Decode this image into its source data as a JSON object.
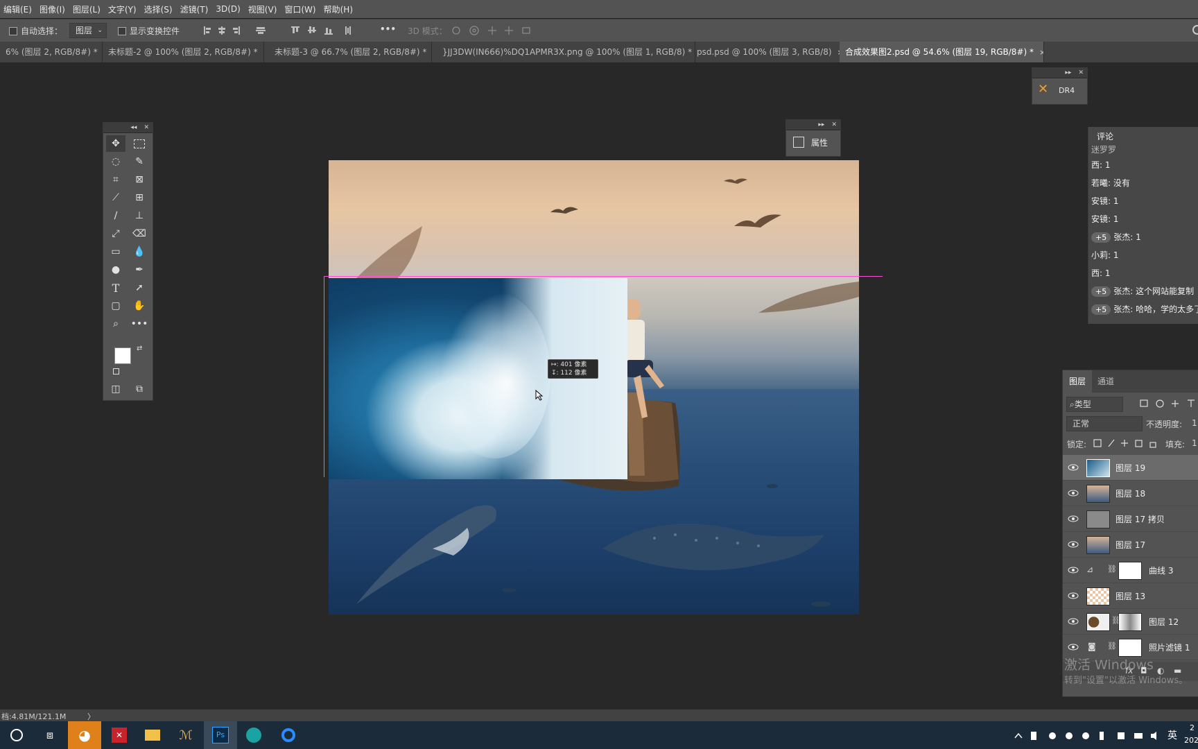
{
  "menu": [
    "编辑(E)",
    "图像(I)",
    "图层(L)",
    "文字(Y)",
    "选择(S)",
    "滤镜(T)",
    "3D(D)",
    "视图(V)",
    "窗口(W)",
    "帮助(H)"
  ],
  "options": {
    "auto_select_label": "自动选择：",
    "auto_select_value": "图层",
    "show_transform_label": "显示变换控件",
    "more": "•••",
    "mode_3d": "3D 模式："
  },
  "tabs": [
    {
      "label": "6% (图层 2, RGB/8#) *",
      "close": "×"
    },
    {
      "label": "未标题-2 @ 100% (图层 2, RGB/8#) *",
      "close": "×"
    },
    {
      "label": "未标题-3 @ 66.7% (图层 2, RGB/8#) *",
      "close": "×"
    },
    {
      "label": "}JJ3DW(IN666)%DQ1APMR3X.png @ 100% (图层 1, RGB/8) *",
      "close": "×"
    },
    {
      "label": "psd.psd @ 100% (图层 3, RGB/8)",
      "close": "×"
    },
    {
      "label": "合成效果图2.psd @ 54.6% (图层 19, RGB/8#) *",
      "close": "×"
    }
  ],
  "tooltip": {
    "line1": "↦: 401 像素",
    "line2": "↧: 112 像素"
  },
  "panels": {
    "properties": "属性",
    "dr4": "DR4",
    "comments_title": "评论"
  },
  "comments": [
    {
      "badge": "",
      "text": "迷罗罗"
    },
    {
      "badge": "",
      "text": "西: 1"
    },
    {
      "badge": "",
      "text": "若曦: 没有"
    },
    {
      "badge": "",
      "text": "安镜: 1"
    },
    {
      "badge": "",
      "text": "安镜: 1"
    },
    {
      "badge": "+5",
      "text": "张杰: 1"
    },
    {
      "badge": "",
      "text": "小莉: 1"
    },
    {
      "badge": "",
      "text": "西: 1"
    },
    {
      "badge": "+5",
      "text": "张杰: 这个网站能复制"
    },
    {
      "badge": "+5",
      "text": "张杰: 哈哈，学的太多了"
    }
  ],
  "layers_panel": {
    "tab_layers": "图层",
    "tab_channels": "通道",
    "filter_kind": "类型",
    "blend_mode": "正常",
    "opacity_label": "不透明度:",
    "opacity_value": "1",
    "lock_label": "锁定:",
    "fill_label": "填充:",
    "fill_value": "1",
    "layers": [
      {
        "name": "图层 19",
        "selected": true
      },
      {
        "name": "图层 18",
        "selected": false
      },
      {
        "name": "图层 17 拷贝",
        "selected": false
      },
      {
        "name": "图层 17",
        "selected": false
      },
      {
        "name": "曲线 3",
        "selected": false
      },
      {
        "name": "图层 13",
        "selected": false
      },
      {
        "name": "图层 12",
        "selected": false
      },
      {
        "name": "照片滤镜 1",
        "selected": false
      }
    ]
  },
  "status": {
    "doc": "档:4.81M/121.1M",
    "arrow": "〉"
  },
  "watermark": {
    "line1": "激活 Windows",
    "line2": "转到\"设置\"以激活 Windows。"
  },
  "taskbar": {
    "lang": "英",
    "time": "2",
    "date": "202"
  },
  "colors": {
    "menubar": "#535353",
    "canvas_bg": "#282828",
    "guide": "#ff4fd8"
  }
}
